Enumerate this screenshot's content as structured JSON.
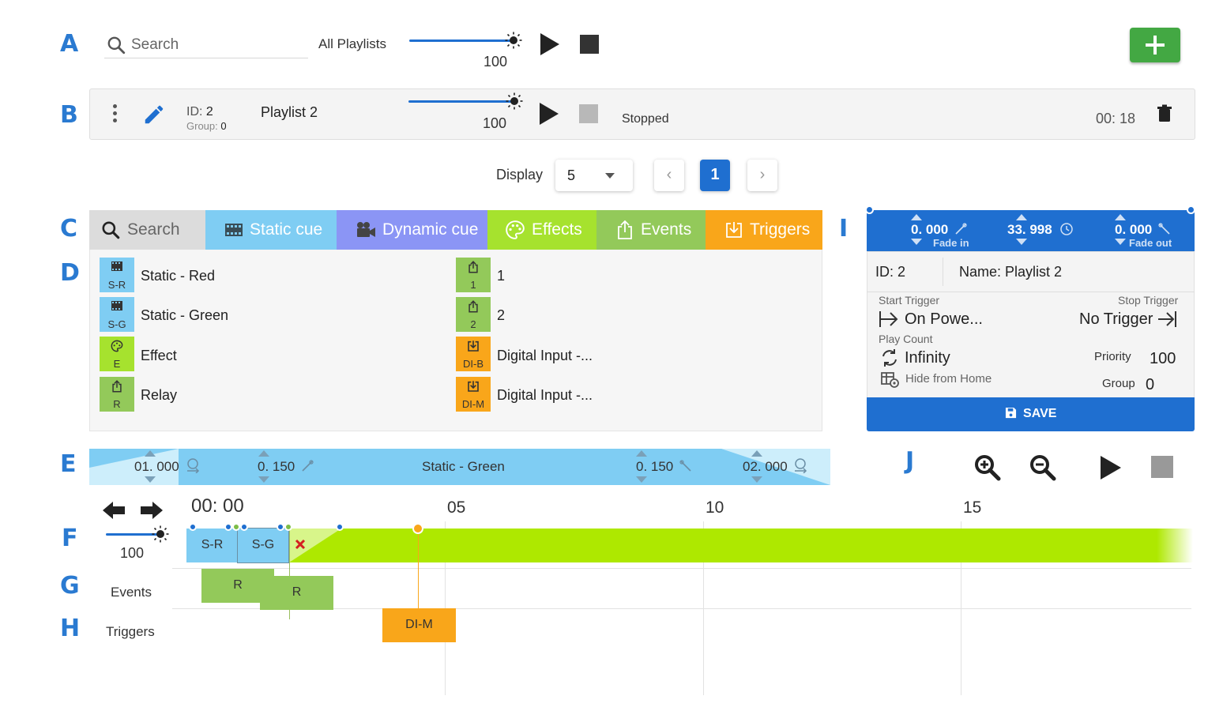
{
  "row_labels": {
    "a": "A",
    "b": "B",
    "c": "C",
    "d": "D",
    "e": "E",
    "f": "F",
    "g": "G",
    "h": "H",
    "i": "I",
    "j": "J"
  },
  "toolbar": {
    "search_placeholder": "Search",
    "all_playlists_label": "All Playlists",
    "master_brightness": "100",
    "brightness_fraction": 1.0
  },
  "playlist_row": {
    "id_label": "ID:",
    "id_value": "2",
    "group_label": "Group:",
    "group_value": "0",
    "name": "Playlist 2",
    "brightness": "100",
    "status": "Stopped",
    "duration": "00: 18"
  },
  "pagination": {
    "display_label": "Display",
    "display_value": "5",
    "prev": "‹",
    "current_page": "1",
    "next": "›"
  },
  "tabs": {
    "search": "Search",
    "static_cue": "Static cue",
    "dynamic_cue": "Dynamic cue",
    "effects": "Effects",
    "events": "Events",
    "triggers": "Triggers"
  },
  "cues_left": [
    {
      "abbr": "S-R",
      "label": "Static - Red",
      "color": "#7fcdf3"
    },
    {
      "abbr": "S-G",
      "label": "Static - Green",
      "color": "#7fcdf3"
    },
    {
      "abbr": "E",
      "label": "Effect",
      "color": "#a6e22e"
    },
    {
      "abbr": "R",
      "label": "Relay",
      "color": "#93c95a"
    }
  ],
  "cues_right": [
    {
      "abbr": "1",
      "label": "1",
      "color": "#93c95a"
    },
    {
      "abbr": "2",
      "label": "2",
      "color": "#93c95a"
    },
    {
      "abbr": "DI-B",
      "label": "Digital Input -...",
      "color": "#f9a61a"
    },
    {
      "abbr": "DI-M",
      "label": "Digital Input -...",
      "color": "#f9a61a"
    }
  ],
  "details": {
    "fade_in_value": "0. 000",
    "fade_in_label": "Fade in",
    "duration_value": "33. 998",
    "fade_out_value": "0. 000",
    "fade_out_label": "Fade out",
    "id_label": "ID:",
    "id_value": "2",
    "name_label": "Name:",
    "name_value": "Playlist 2",
    "start_trigger_label": "Start Trigger",
    "start_trigger_value": "On Powe...",
    "stop_trigger_label": "Stop Trigger",
    "stop_trigger_value": "No Trigger",
    "play_count_label": "Play Count",
    "play_count_value": "Infinity",
    "priority_label": "Priority",
    "priority_value": "100",
    "hide_label": "Hide from Home",
    "group_label": "Group",
    "group_value": "0",
    "save_label": "SAVE"
  },
  "cue_editor": {
    "start_delay": "01. 000",
    "fade_in": "0. 150",
    "name": "Static - Green",
    "fade_out": "0. 150",
    "end_delay": "02. 000"
  },
  "timeline": {
    "current_time": "00: 00",
    "ticks": [
      "05",
      "10",
      "15"
    ],
    "brightness": "100",
    "events_label": "Events",
    "triggers_label": "Triggers",
    "cue_blocks": [
      "S-R",
      "S-G"
    ],
    "event_blocks": [
      "R",
      "R"
    ],
    "trigger_blocks": [
      "DI-M"
    ]
  },
  "colors": {
    "accent": "#1f6fd0",
    "add_green": "#43a843",
    "static_cue": "#7fcdf3",
    "dynamic_cue": "#8b95f5",
    "effects": "#a6e22e",
    "events": "#93c95a",
    "triggers": "#f9a61a"
  }
}
